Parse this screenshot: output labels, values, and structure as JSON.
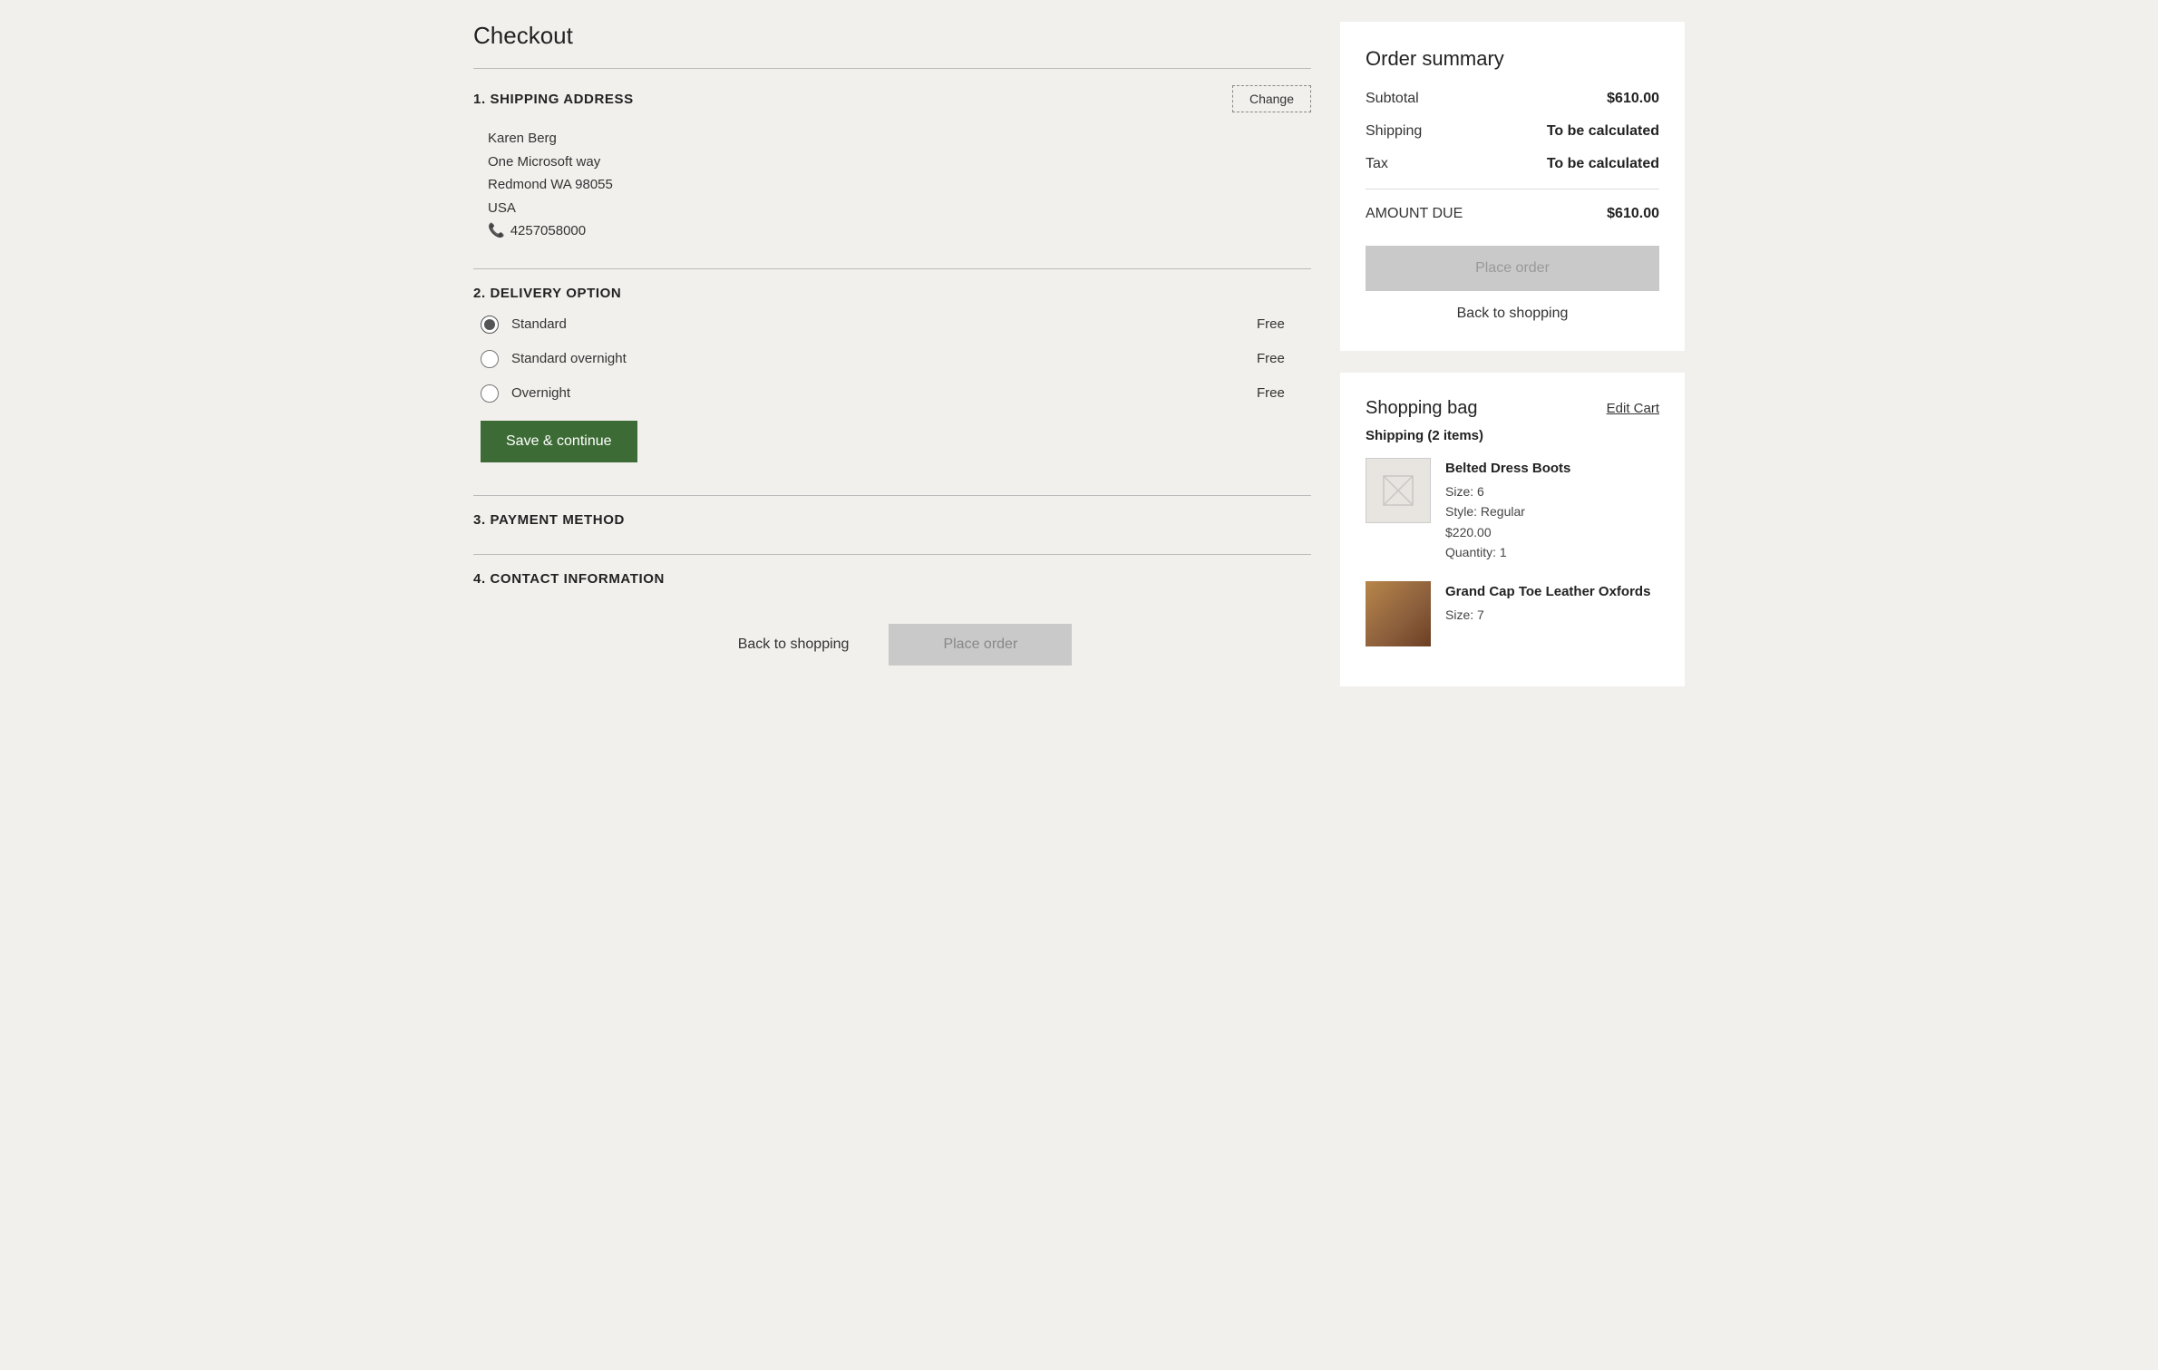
{
  "page": {
    "title": "Checkout"
  },
  "sections": {
    "shipping": {
      "number": "1.",
      "title": "SHIPPING ADDRESS",
      "change_label": "Change",
      "address": {
        "name": "Karen Berg",
        "street": "One Microsoft way",
        "city_state_zip": "Redmond WA  98055",
        "country": "USA",
        "phone": "4257058000"
      }
    },
    "delivery": {
      "number": "2.",
      "title": "DELIVERY OPTION",
      "options": [
        {
          "id": "standard",
          "label": "Standard",
          "price": "Free",
          "selected": true
        },
        {
          "id": "standard_overnight",
          "label": "Standard overnight",
          "price": "Free",
          "selected": false
        },
        {
          "id": "overnight",
          "label": "Overnight",
          "price": "Free",
          "selected": false
        }
      ],
      "save_label": "Save & continue"
    },
    "payment": {
      "number": "3.",
      "title": "PAYMENT METHOD"
    },
    "contact": {
      "number": "4.",
      "title": "CONTACT INFORMATION"
    }
  },
  "bottom_actions": {
    "back_label": "Back to shopping",
    "place_order_label": "Place order"
  },
  "order_summary": {
    "title": "Order summary",
    "rows": [
      {
        "label": "Subtotal",
        "value": "$610.00",
        "bold_value": true
      },
      {
        "label": "Shipping",
        "value": "To be calculated",
        "bold_value": true
      },
      {
        "label": "Tax",
        "value": "To be calculated",
        "bold_value": true
      },
      {
        "label": "AMOUNT DUE",
        "value": "$610.00",
        "bold_value": true,
        "divider": true
      }
    ],
    "place_order_label": "Place order",
    "back_to_shopping_label": "Back to shopping"
  },
  "shopping_bag": {
    "title": "Shopping bag",
    "edit_cart_label": "Edit Cart",
    "shipping_group_label": "Shipping (2 items)",
    "items": [
      {
        "name": "Belted Dress Boots",
        "size": "Size: 6",
        "style": "Style: Regular",
        "price": "$220.00",
        "quantity": "Quantity: 1",
        "has_image": false
      },
      {
        "name": "Grand Cap Toe Leather Oxfords",
        "size": "Size: 7",
        "has_image": true
      }
    ]
  }
}
